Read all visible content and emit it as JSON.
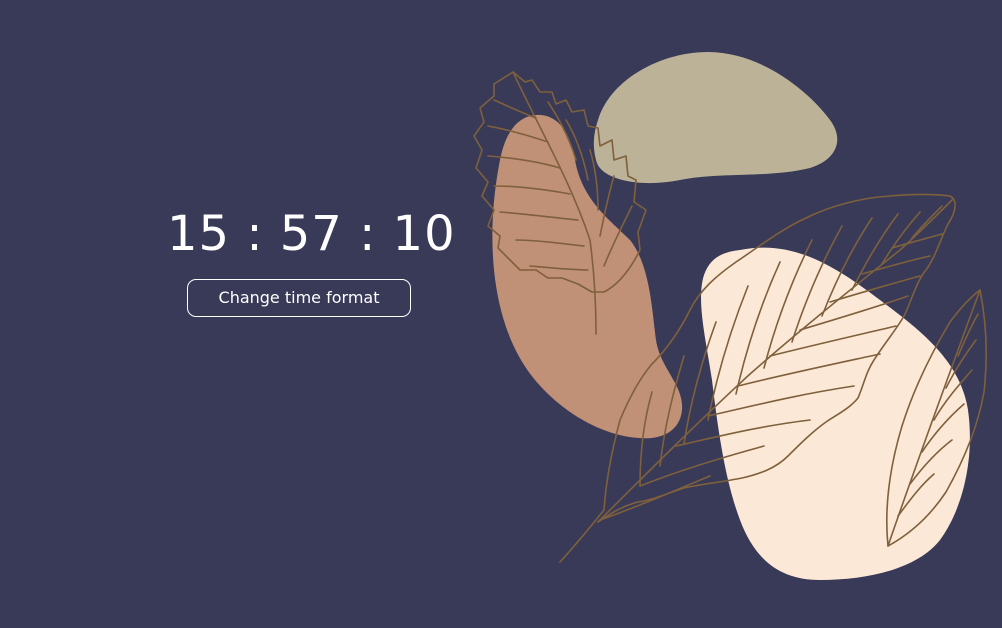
{
  "clock": {
    "time": "15 : 57 : 10"
  },
  "controls": {
    "change_format_label": "Change time format"
  },
  "colors": {
    "background": "#393a58",
    "text": "#ffffff",
    "blob_sage": "#bcb298",
    "blob_terracotta": "#c09077",
    "blob_cream": "#fce8d6",
    "leaf_outline": "#7e603c"
  }
}
